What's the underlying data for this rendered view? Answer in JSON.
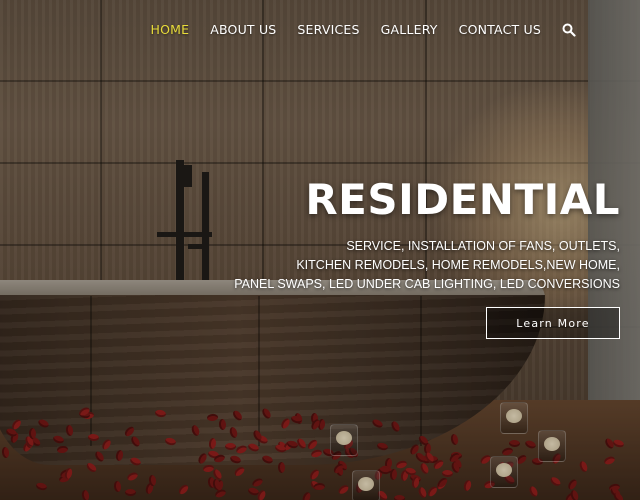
{
  "nav": {
    "items": [
      {
        "label": "HOME",
        "active": true
      },
      {
        "label": "ABOUT US",
        "active": false
      },
      {
        "label": "SERVICES",
        "active": false
      },
      {
        "label": "GALLERY",
        "active": false
      },
      {
        "label": "CONTACT US",
        "active": false
      }
    ],
    "search_icon": "search-icon",
    "active_color": "#e8dc3a"
  },
  "hero": {
    "title": "RESIDENTIAL",
    "lines": [
      "SERVICE, INSTALLATION OF FANS, OUTLETS,",
      "KITCHEN REMODELS, HOME REMODELS,NEW HOME,",
      "PANEL SWAPS, LED UNDER CAB LIGHTING, LED CONVERSIONS"
    ],
    "button_label": "Learn More"
  }
}
